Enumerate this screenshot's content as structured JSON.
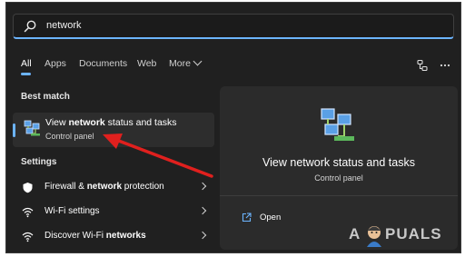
{
  "search": {
    "value": "network"
  },
  "tabs": [
    {
      "label": "All",
      "active": true
    },
    {
      "label": "Apps"
    },
    {
      "label": "Documents"
    },
    {
      "label": "Web"
    },
    {
      "label": "More"
    }
  ],
  "best_match": {
    "heading": "Best match",
    "title_pre": "View ",
    "title_bold": "network",
    "title_post": " status and tasks",
    "subtitle": "Control panel"
  },
  "settings": {
    "heading": "Settings",
    "items": [
      {
        "pre": "Firewall & ",
        "bold": "network",
        "post": " protection",
        "icon": "shield-icon"
      },
      {
        "pre": "Wi-Fi settings",
        "bold": "",
        "post": "",
        "icon": "wifi-icon"
      },
      {
        "pre": "Discover Wi-Fi ",
        "bold": "networks",
        "post": "",
        "icon": "wifi-icon"
      }
    ]
  },
  "preview": {
    "title": "View network status and tasks",
    "subtitle": "Control panel",
    "open_label": "Open"
  },
  "watermark": {
    "text_a": "A",
    "text_b": "PUALS"
  },
  "colors": {
    "accent": "#6cb4ff",
    "annotation_arrow": "#e0201e",
    "background": "#202020"
  }
}
